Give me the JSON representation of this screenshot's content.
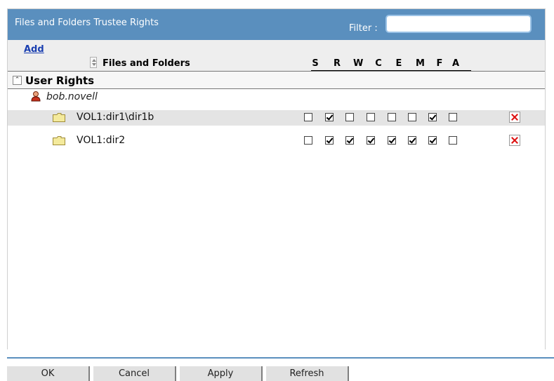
{
  "title": "Files and Folders Trustee Rights",
  "filter": {
    "label": "Filter :",
    "value": "",
    "placeholder": ""
  },
  "add_link": "Add",
  "columns": {
    "files_and_folders": "Files and Folders",
    "rights": [
      "S",
      "R",
      "W",
      "C",
      "E",
      "M",
      "F",
      "A"
    ]
  },
  "section_title": "User Rights",
  "trustee": {
    "name": "bob.novell",
    "icon": "user-icon"
  },
  "rows": [
    {
      "name": "VOL1:dir1\\dir1b",
      "icon": "folder-icon",
      "rights": [
        false,
        true,
        false,
        false,
        false,
        false,
        true,
        false
      ],
      "delete_icon": "delete-icon"
    },
    {
      "name": "VOL1:dir2",
      "icon": "folder-icon",
      "rights": [
        false,
        true,
        true,
        true,
        true,
        true,
        true,
        false
      ],
      "delete_icon": "delete-icon"
    }
  ],
  "buttons": {
    "ok": "OK",
    "cancel": "Cancel",
    "apply": "Apply",
    "refresh": "Refresh"
  },
  "colors": {
    "header_blue": "#5a8fbe",
    "filter_border": "#9ac2e6",
    "link": "#1a3fb0",
    "delete_red": "#d11111",
    "row_alt": "#e4e4e4"
  }
}
